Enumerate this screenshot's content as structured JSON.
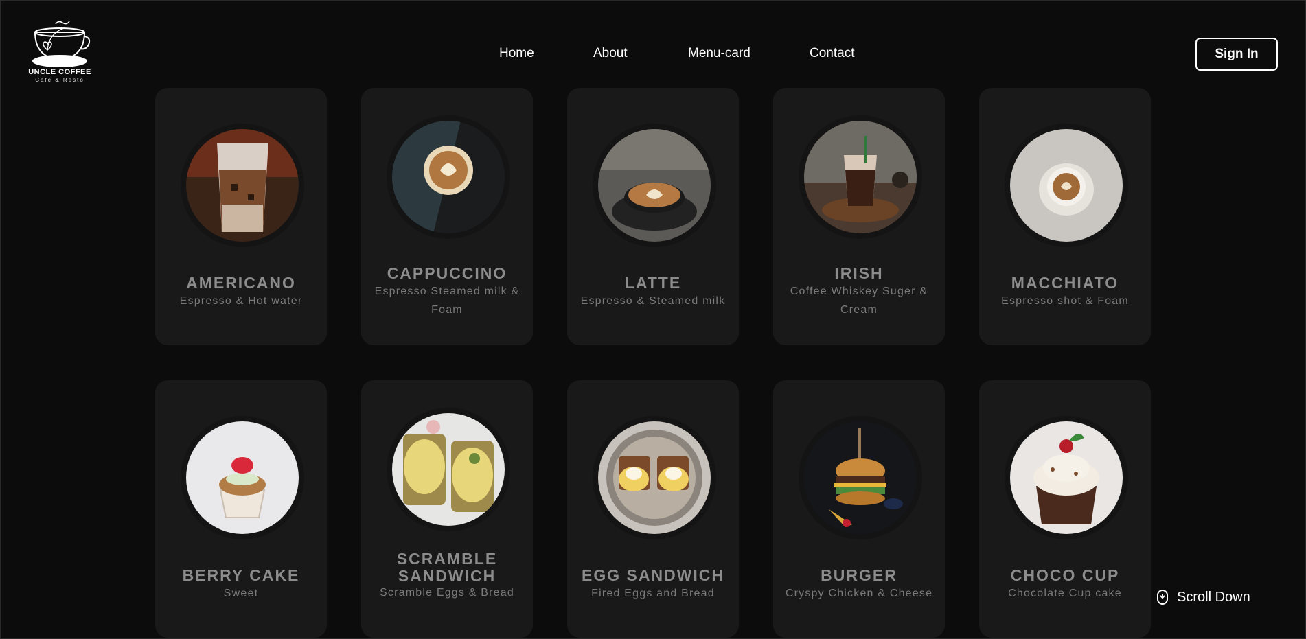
{
  "logo": {
    "title": "UNCLE COFFEE",
    "subtitle": "Cafe & Resto",
    "icon": "coffee-cup-logo"
  },
  "nav": {
    "items": [
      {
        "label": "Home"
      },
      {
        "label": "About"
      },
      {
        "label": "Menu-card"
      },
      {
        "label": "Contact"
      }
    ]
  },
  "header": {
    "signin_label": "Sign In"
  },
  "menu": {
    "row1": [
      {
        "name": "AMERICANO",
        "desc": "Espresso & Hot water"
      },
      {
        "name": "CAPPUCCINO",
        "desc": "Espresso Steamed milk & Foam"
      },
      {
        "name": "LATTE",
        "desc": "Espresso & Steamed milk"
      },
      {
        "name": "IRISH",
        "desc": "Coffee Whiskey Suger & Cream"
      },
      {
        "name": "MACCHIATO",
        "desc": "Espresso shot & Foam"
      }
    ],
    "row2": [
      {
        "name": "BERRY CAKE",
        "desc": "Sweet"
      },
      {
        "name": "SCRAMBLE SANDWICH",
        "desc": "Scramble Eggs & Bread"
      },
      {
        "name": "EGG SANDWICH",
        "desc": "Fired Eggs and Bread"
      },
      {
        "name": "BURGER",
        "desc": "Cryspy Chicken & Cheese"
      },
      {
        "name": "CHOCO CUP",
        "desc": "Chocolate Cup cake"
      }
    ]
  },
  "scroll": {
    "label": "Scroll Down",
    "icon": "mouse-icon"
  },
  "colors": {
    "background": "#0c0c0c",
    "card": "#191919",
    "text": "#ffffff",
    "muted": "#8c8c8c"
  }
}
